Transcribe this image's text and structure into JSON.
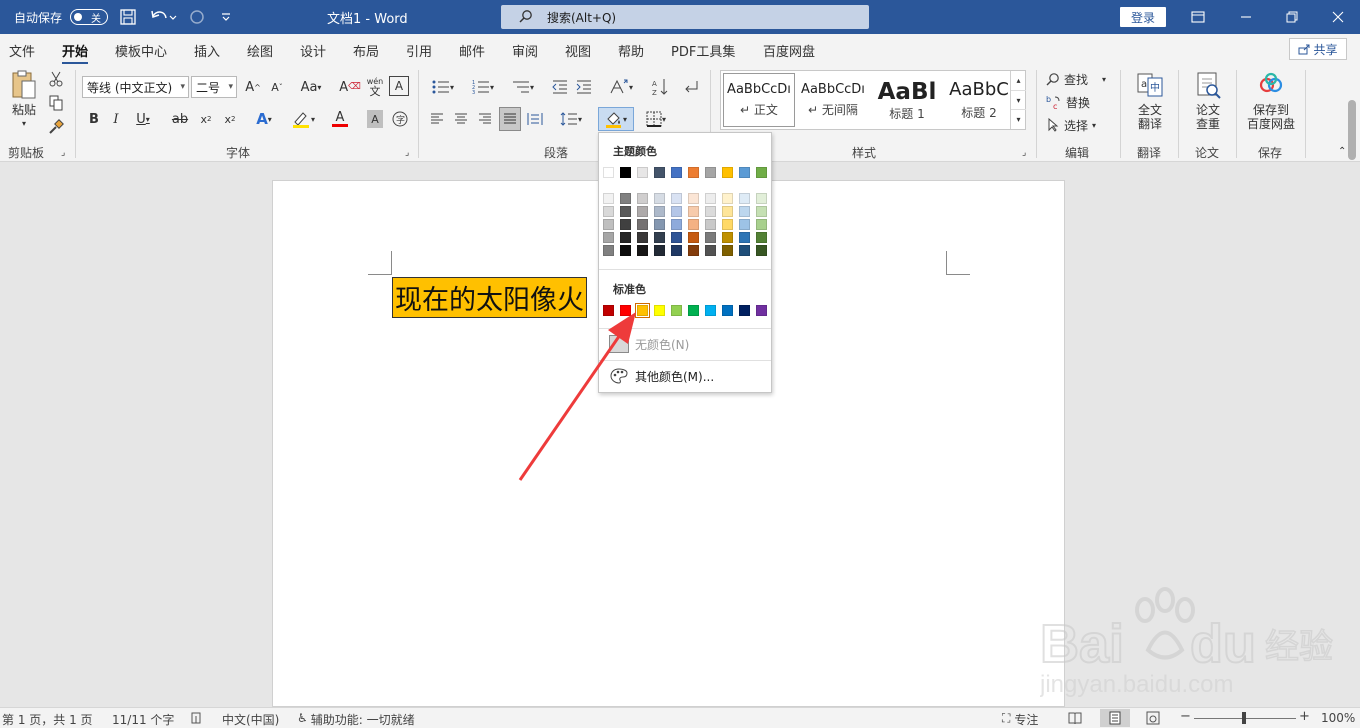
{
  "titlebar": {
    "autosave_label": "自动保存",
    "autosave_state": "关",
    "doc_title": "文档1  -  Word",
    "search_placeholder": "搜索(Alt+Q)",
    "login_label": "登录"
  },
  "tabs": [
    "文件",
    "开始",
    "模板中心",
    "插入",
    "绘图",
    "设计",
    "布局",
    "引用",
    "邮件",
    "审阅",
    "视图",
    "帮助",
    "PDF工具集",
    "百度网盘"
  ],
  "active_tab": "开始",
  "share_label": "共享",
  "ribbon": {
    "clipboard": {
      "paste_label": "粘贴",
      "group_label": "剪贴板"
    },
    "font": {
      "font_name": "等线 (中文正文)",
      "font_size": "二号",
      "group_label": "字体",
      "wen_label": "wén",
      "wen_char": "文"
    },
    "paragraph": {
      "group_label": "段落"
    },
    "styles": {
      "group_label": "样式",
      "items": [
        {
          "sample": "AaBbCcDı",
          "name": "正文"
        },
        {
          "sample": "AaBbCcDı",
          "name": "无间隔"
        },
        {
          "sample": "AaBl",
          "name": "标题 1"
        },
        {
          "sample": "AaBbC",
          "name": "标题 2"
        }
      ]
    },
    "editing": {
      "find_label": "查找",
      "replace_label": "替换",
      "select_label": "选择",
      "group_label": "编辑"
    },
    "translate": {
      "button_label_1": "全文",
      "button_label_2": "翻译",
      "group_label": "翻译"
    },
    "paper": {
      "button_label_1": "论文",
      "button_label_2": "查重",
      "group_label": "论文"
    },
    "save": {
      "button_label_1": "保存到",
      "button_label_2": "百度网盘",
      "group_label": "保存"
    }
  },
  "document": {
    "text": "现在的太阳像火"
  },
  "color_menu": {
    "theme_heading": "主题颜色",
    "standard_heading": "标准色",
    "no_color_label": "无颜色(N)",
    "more_colors_label": "其他颜色(M)...",
    "theme_top": [
      "#ffffff",
      "#000000",
      "#e7e6e6",
      "#44546a",
      "#4472c4",
      "#ed7d31",
      "#a5a5a5",
      "#ffc000",
      "#5b9bd5",
      "#70ad47"
    ],
    "theme_shades": [
      [
        "#f2f2f2",
        "#d9d9d9",
        "#bfbfbf",
        "#a6a6a6",
        "#808080"
      ],
      [
        "#808080",
        "#595959",
        "#404040",
        "#262626",
        "#0d0d0d"
      ],
      [
        "#d0cece",
        "#aeaaaa",
        "#757171",
        "#3a3838",
        "#171616"
      ],
      [
        "#d6dce4",
        "#adb9ca",
        "#8497b0",
        "#333f4f",
        "#222a35"
      ],
      [
        "#d9e2f3",
        "#b4c6e7",
        "#8eaadb",
        "#2f5496",
        "#1f3864"
      ],
      [
        "#fbe5d5",
        "#f7cbac",
        "#f4b183",
        "#c55a11",
        "#833c0b"
      ],
      [
        "#ededed",
        "#dbdbdb",
        "#c9c9c9",
        "#7b7b7b",
        "#525252"
      ],
      [
        "#fff2cc",
        "#fee599",
        "#ffd966",
        "#bf9000",
        "#7f6000"
      ],
      [
        "#deebf6",
        "#bdd7ee",
        "#9dc3e6",
        "#2e75b5",
        "#1f4e79"
      ],
      [
        "#e2efd9",
        "#c5e0b3",
        "#a8d08d",
        "#538135",
        "#375623"
      ]
    ],
    "standard": [
      "#c00000",
      "#ff0000",
      "#ffc000",
      "#ffff00",
      "#92d050",
      "#00b050",
      "#00b0f0",
      "#0070c0",
      "#002060",
      "#7030a0"
    ],
    "selected_standard_index": 2
  },
  "statusbar": {
    "page_info": "第 1 页，共 1 页",
    "word_count": "11/11 个字",
    "language": "中文(中国)",
    "accessibility": "辅助功能: 一切就绪",
    "focus": "专注",
    "zoom": "100%"
  },
  "colors": {
    "accent": "#2b579a",
    "highlight": "#ffc000",
    "arrow": "#ee3b3b"
  }
}
